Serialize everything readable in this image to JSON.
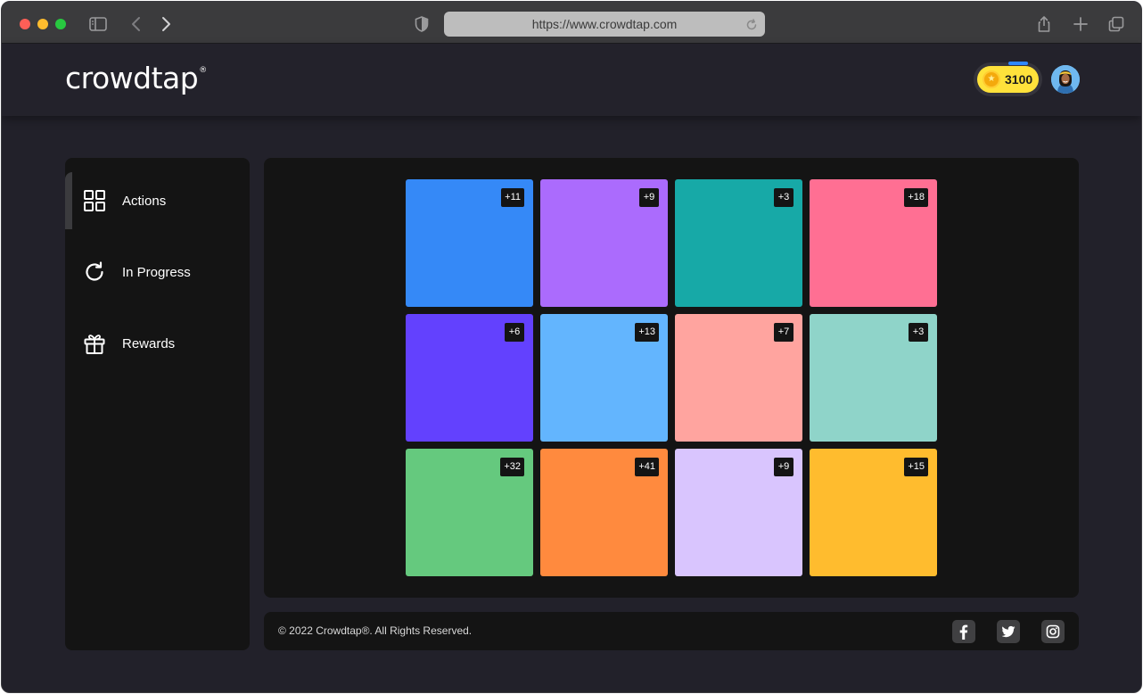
{
  "browser": {
    "url": "https://www.crowdtap.com",
    "icons": [
      "sidebar-toggle-icon",
      "back-icon",
      "forward-icon",
      "shield-icon",
      "reload-icon",
      "share-icon",
      "new-tab-icon",
      "tabs-overview-icon"
    ]
  },
  "header": {
    "logo_text": "crowdtap",
    "logo_mark": "®",
    "points": "3100",
    "points_color": "#ffe23b"
  },
  "sidebar": {
    "items": [
      {
        "label": "Actions",
        "icon": "grid-icon",
        "active": true
      },
      {
        "label": "In Progress",
        "icon": "refresh-icon",
        "active": false
      },
      {
        "label": "Rewards",
        "icon": "gift-icon",
        "active": false
      }
    ]
  },
  "tiles": [
    {
      "badge": "+11",
      "color": "#3589f7"
    },
    {
      "badge": "+9",
      "color": "#ab6bfd"
    },
    {
      "badge": "+3",
      "color": "#17a9a7"
    },
    {
      "badge": "+18",
      "color": "#ff6f93"
    },
    {
      "badge": "+6",
      "color": "#6341fe"
    },
    {
      "badge": "+13",
      "color": "#63b5fe"
    },
    {
      "badge": "+7",
      "color": "#ffa49f"
    },
    {
      "badge": "+3",
      "color": "#8fd4c9"
    },
    {
      "badge": "+32",
      "color": "#65c97e"
    },
    {
      "badge": "+41",
      "color": "#ff8a3e"
    },
    {
      "badge": "+9",
      "color": "#d9c5fe"
    },
    {
      "badge": "+15",
      "color": "#ffbc2e"
    }
  ],
  "footer": {
    "copyright": "© 2022 Crowdtap®. All Rights Reserved.",
    "social": [
      "facebook-icon",
      "twitter-icon",
      "instagram-icon"
    ]
  }
}
